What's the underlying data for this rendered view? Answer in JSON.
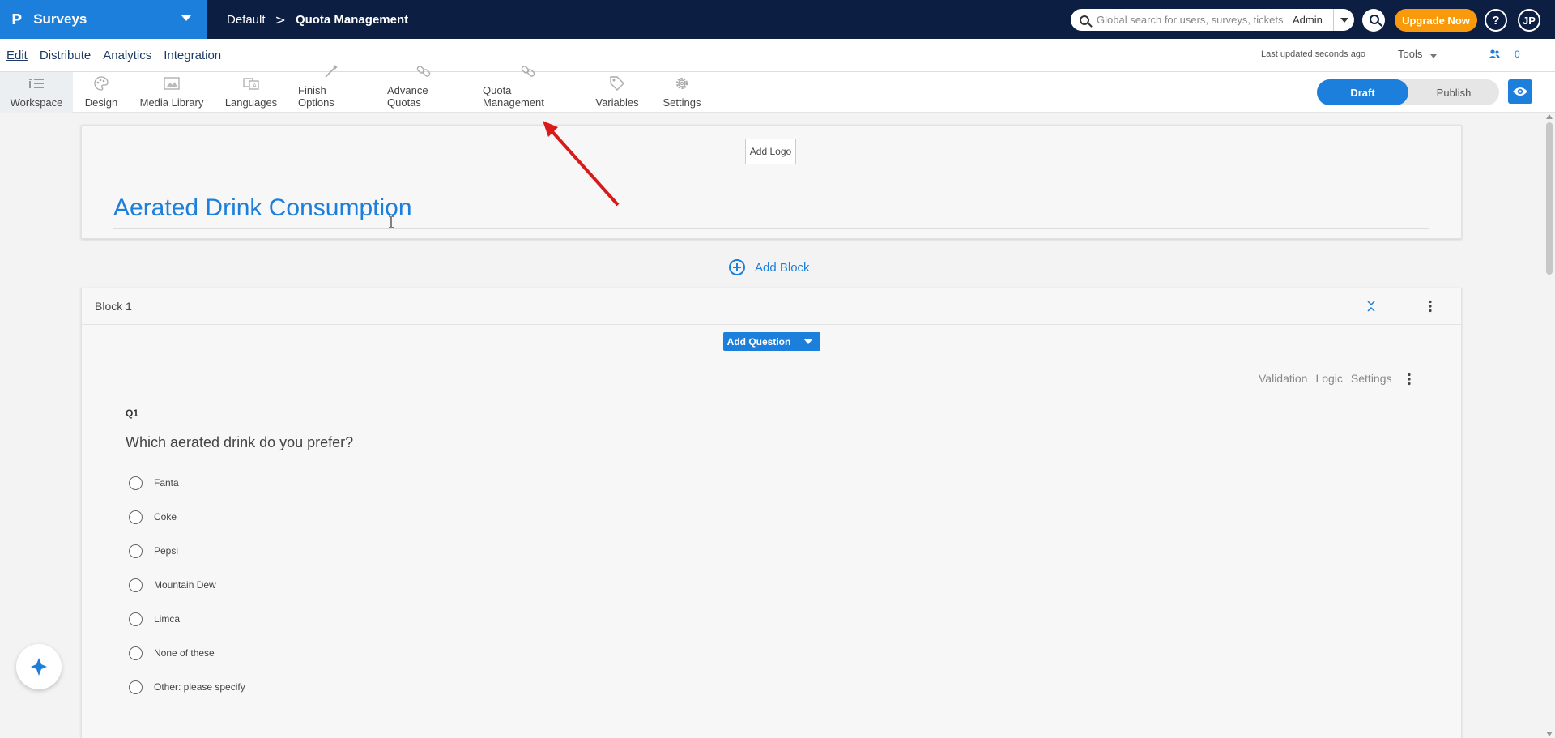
{
  "app": {
    "brand_logo_glyph": "P",
    "product": "Surveys",
    "breadcrumb": {
      "workspace": "Default",
      "separator": ">",
      "current": "Quota Management"
    }
  },
  "header": {
    "search_placeholder": "Global search for users, surveys, tickets",
    "search_scope": "Admin",
    "upgrade_label": "Upgrade Now",
    "help_label": "?",
    "avatar_initials": "JP"
  },
  "subnav": {
    "links": [
      "Edit",
      "Distribute",
      "Analytics",
      "Integration"
    ],
    "updated_text": "Last updated seconds ago",
    "tools_label": "Tools",
    "collaborators_count": "0"
  },
  "toolbar": {
    "items": [
      {
        "label": "Workspace",
        "icon": "workspace-icon"
      },
      {
        "label": "Design",
        "icon": "palette-icon"
      },
      {
        "label": "Media Library",
        "icon": "image-icon"
      },
      {
        "label": "Languages",
        "icon": "translate-icon"
      },
      {
        "label": "Finish Options",
        "icon": "magic-wand-icon"
      },
      {
        "label": "Advance Quotas",
        "icon": "quota-link-icon"
      },
      {
        "label": "Quota Management",
        "icon": "quota-link-icon"
      },
      {
        "label": "Variables",
        "icon": "tag-icon"
      },
      {
        "label": "Settings",
        "icon": "gear-icon"
      }
    ],
    "draft_label": "Draft",
    "publish_label": "Publish"
  },
  "survey": {
    "add_logo_label": "Add Logo",
    "title": "Aerated Drink Consumption",
    "add_block_label": "Add Block"
  },
  "block": {
    "title": "Block 1",
    "add_question_label": "Add Question",
    "question_tools": [
      "Validation",
      "Logic",
      "Settings"
    ],
    "question": {
      "number": "Q1",
      "text": "Which aerated drink do you prefer?",
      "options": [
        "Fanta",
        "Coke",
        "Pepsi",
        "Mountain Dew",
        "Limca",
        "None of these",
        "Other: please specify"
      ]
    }
  },
  "colors": {
    "topbar": "#0c1e42",
    "brand": "#1c7fdb",
    "accent": "#1c7fdb",
    "upgrade": "#f89a0b",
    "annotation_arrow": "#d91a1a"
  }
}
